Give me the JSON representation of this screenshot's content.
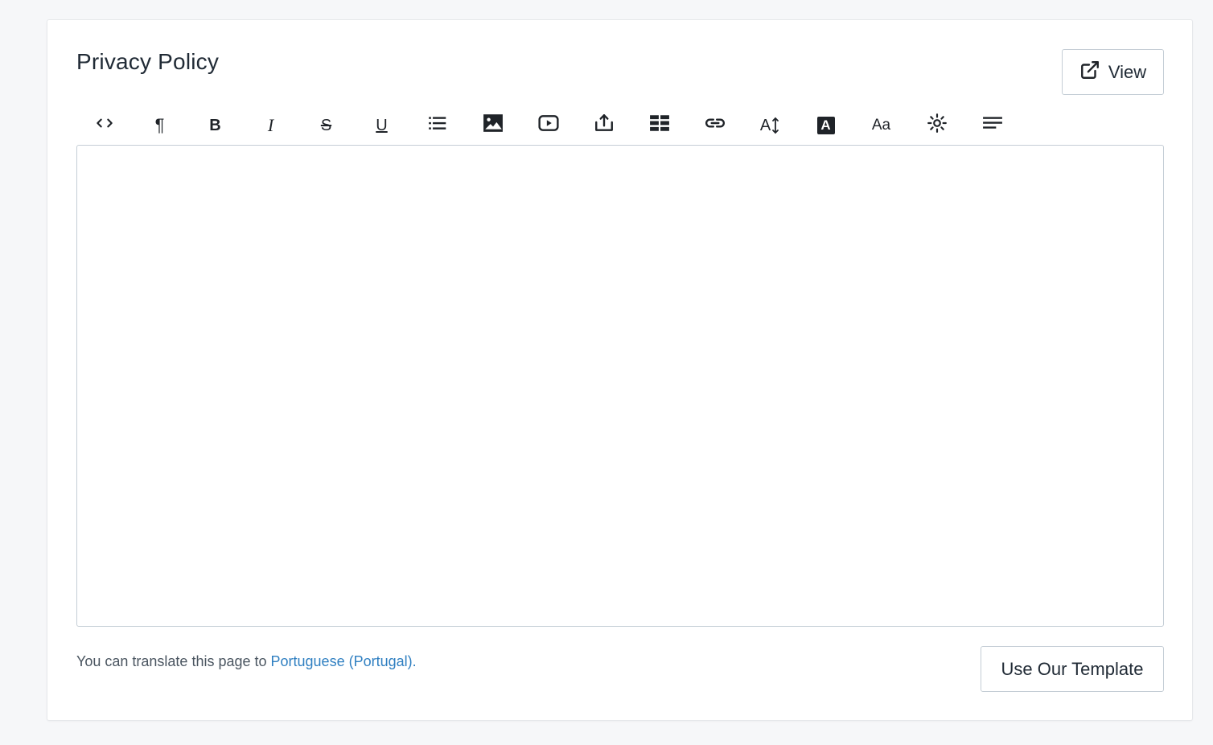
{
  "section": {
    "title": "Privacy Policy"
  },
  "view_button": {
    "label": "View",
    "icon": "external-link-icon"
  },
  "toolbar": {
    "tools": [
      {
        "name": "code-view",
        "icon": "code-icon"
      },
      {
        "name": "paragraph-format",
        "icon": "paragraph-icon",
        "glyph": "¶"
      },
      {
        "name": "bold",
        "icon": "bold-icon",
        "glyph": "B"
      },
      {
        "name": "italic",
        "icon": "italic-icon",
        "glyph": "I"
      },
      {
        "name": "strikethrough",
        "icon": "strikethrough-icon",
        "glyph": "S"
      },
      {
        "name": "underline",
        "icon": "underline-icon",
        "glyph": "U"
      },
      {
        "name": "bulleted-list",
        "icon": "list-icon"
      },
      {
        "name": "insert-image",
        "icon": "image-icon"
      },
      {
        "name": "insert-video",
        "icon": "video-icon"
      },
      {
        "name": "insert-file",
        "icon": "upload-icon"
      },
      {
        "name": "insert-table",
        "icon": "table-icon"
      },
      {
        "name": "insert-link",
        "icon": "link-icon"
      },
      {
        "name": "font-size",
        "icon": "font-size-icon",
        "glyph": "A"
      },
      {
        "name": "text-color",
        "icon": "text-color-icon",
        "glyph": "A"
      },
      {
        "name": "font-family",
        "icon": "font-family-icon",
        "glyph": "Aa"
      },
      {
        "name": "special-characters",
        "icon": "sun-icon"
      },
      {
        "name": "align",
        "icon": "align-left-icon"
      }
    ]
  },
  "editor": {
    "content": ""
  },
  "footer": {
    "translate_prefix": "You can translate this page to ",
    "translate_link": "Portuguese (Portugal).",
    "link_color": "#2f7fc1"
  },
  "template_button": {
    "label": "Use Our Template"
  }
}
